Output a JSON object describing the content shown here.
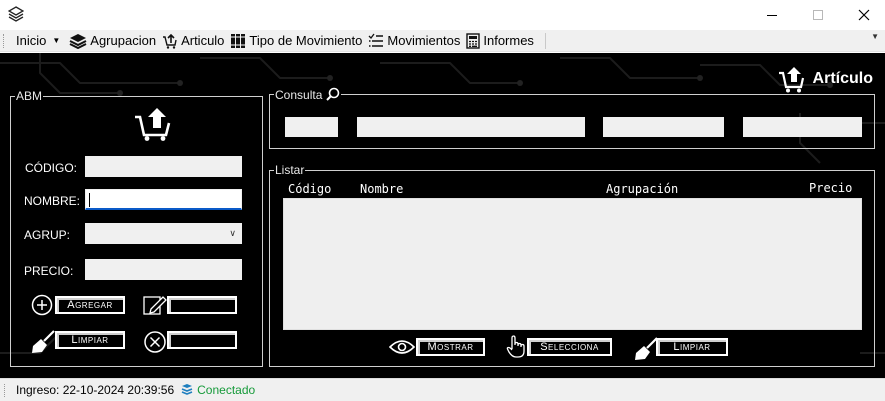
{
  "menu": {
    "items": [
      {
        "label": "Inicio",
        "icon": "inicio"
      },
      {
        "label": "Agrupacion",
        "icon": "layers-icon"
      },
      {
        "label": "Articulo",
        "icon": "cart-upload-icon"
      },
      {
        "label": "Tipo de Movimiento",
        "icon": "books-icon"
      },
      {
        "label": "Movimientos",
        "icon": "list-icon"
      },
      {
        "label": "Informes",
        "icon": "report-icon"
      }
    ]
  },
  "header": {
    "title": "Artículo"
  },
  "abm": {
    "legend": "ABM",
    "codigo_label": "CÓDIGO:",
    "nombre_label": "NOMBRE:",
    "agrup_label": "AGRUP:",
    "precio_label": "PRECIO:",
    "codigo_value": "",
    "nombre_value": "",
    "agrup_value": "",
    "precio_value": "",
    "agregar_label": "Agregar",
    "modificar_label": "",
    "limpiar_label": "Limpiar",
    "eliminar_label": ""
  },
  "consulta": {
    "legend": "Consulta",
    "inputs": [
      "",
      "",
      "",
      ""
    ]
  },
  "listar": {
    "legend": "Listar",
    "columns": [
      "Código",
      "Nombre",
      "Agrupación",
      "Precio"
    ],
    "rows": [],
    "mostrar_label": "Mostrar",
    "selecciona_label": "Selecciona",
    "limpiar_label": "Limpiar"
  },
  "status": {
    "ingreso": "Ingreso: 22-10-2024 20:39:56",
    "conexion": "Conectado",
    "conexion_color": "#169a3a"
  }
}
